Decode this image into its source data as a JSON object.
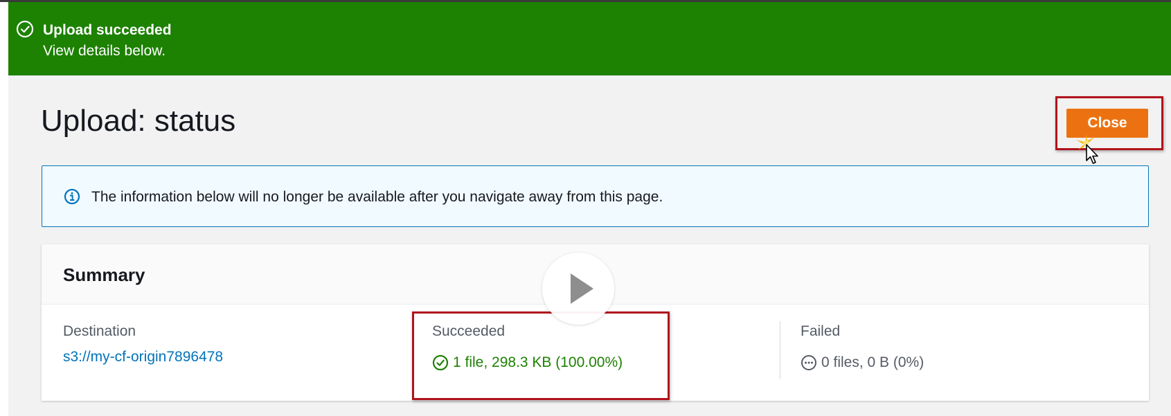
{
  "flash": {
    "title": "Upload succeeded",
    "subtitle": "View details below.",
    "icon": "success-check-circle-icon",
    "color": "#1d8102"
  },
  "page": {
    "title": "Upload: status",
    "close_label": "Close"
  },
  "info_alert": {
    "text": "The information below will no longer be available after you navigate away from this page.",
    "icon": "info-icon"
  },
  "summary": {
    "title": "Summary",
    "destination": {
      "label": "Destination",
      "value": "s3://my-cf-origin7896478"
    },
    "succeeded": {
      "label": "Succeeded",
      "value": "1 file, 298.3 KB (100.00%)",
      "icon": "success-check-circle-icon"
    },
    "failed": {
      "label": "Failed",
      "value": "0 files, 0 B (0%)",
      "icon": "ellipsis-circle-icon"
    }
  },
  "overlay": {
    "play_icon": "play-icon",
    "cursor_icon": "mouse-pointer-icon"
  },
  "colors": {
    "accent_orange": "#ec7211",
    "success_green": "#1d8102",
    "link_blue": "#0073bb",
    "highlight_red": "#b0121b"
  }
}
